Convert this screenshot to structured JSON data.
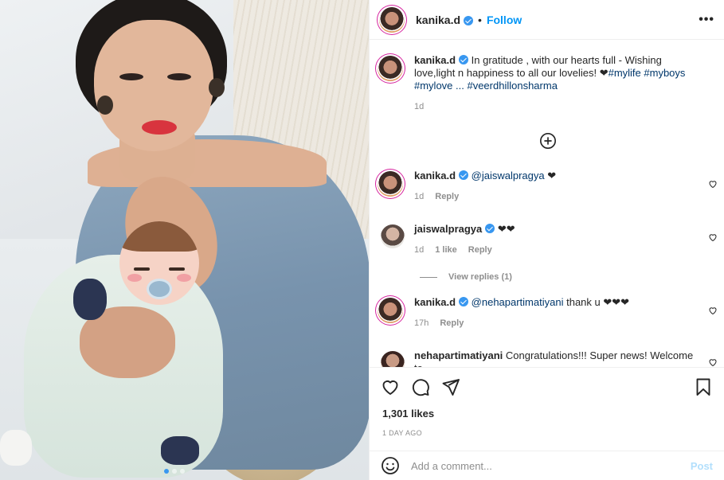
{
  "header": {
    "username": "kanika.d",
    "separator": "•",
    "follow_label": "Follow",
    "more_label": "•••"
  },
  "caption": {
    "username": "kanika.d",
    "text": "In gratitude , with our hearts full - Wishing love,light n happiness to all our lovelies! ❤",
    "hashtags": "#mylife #myboys #mylove ... #veerdhillonsharma",
    "time": "1d"
  },
  "comments": [
    {
      "username": "kanika.d",
      "mention": "@jaiswalpragya",
      "text": " ❤",
      "time": "1d",
      "likes": "",
      "reply_label": "Reply"
    },
    {
      "username": "jaiswalpragya",
      "mention": "",
      "text": "❤❤",
      "time": "1d",
      "likes": "1 like",
      "reply_label": "Reply"
    },
    {
      "username": "kanika.d",
      "mention": "@nehapartimatiyani",
      "text": " thank u ❤❤❤",
      "time": "17h",
      "likes": "",
      "reply_label": "Reply"
    },
    {
      "username": "nehapartimatiyani",
      "mention": "",
      "text": "Congratulations!!! Super news! Welcome to",
      "time": "",
      "likes": "",
      "reply_label": ""
    }
  ],
  "view_replies": "View replies (1)",
  "likes_count": "1,301 likes",
  "posted_ago": "1 DAY AGO",
  "comment_placeholder": "Add a comment...",
  "post_label": "Post",
  "colors": {
    "accent": "#0095f6",
    "verified": "#3897f0",
    "link": "#00376b",
    "muted": "#8e8e8e"
  },
  "icons": [
    "heart-icon",
    "comment-icon",
    "share-icon",
    "bookmark-icon",
    "emoji-icon",
    "plus-circle-icon",
    "more-icon",
    "verified-icon"
  ]
}
